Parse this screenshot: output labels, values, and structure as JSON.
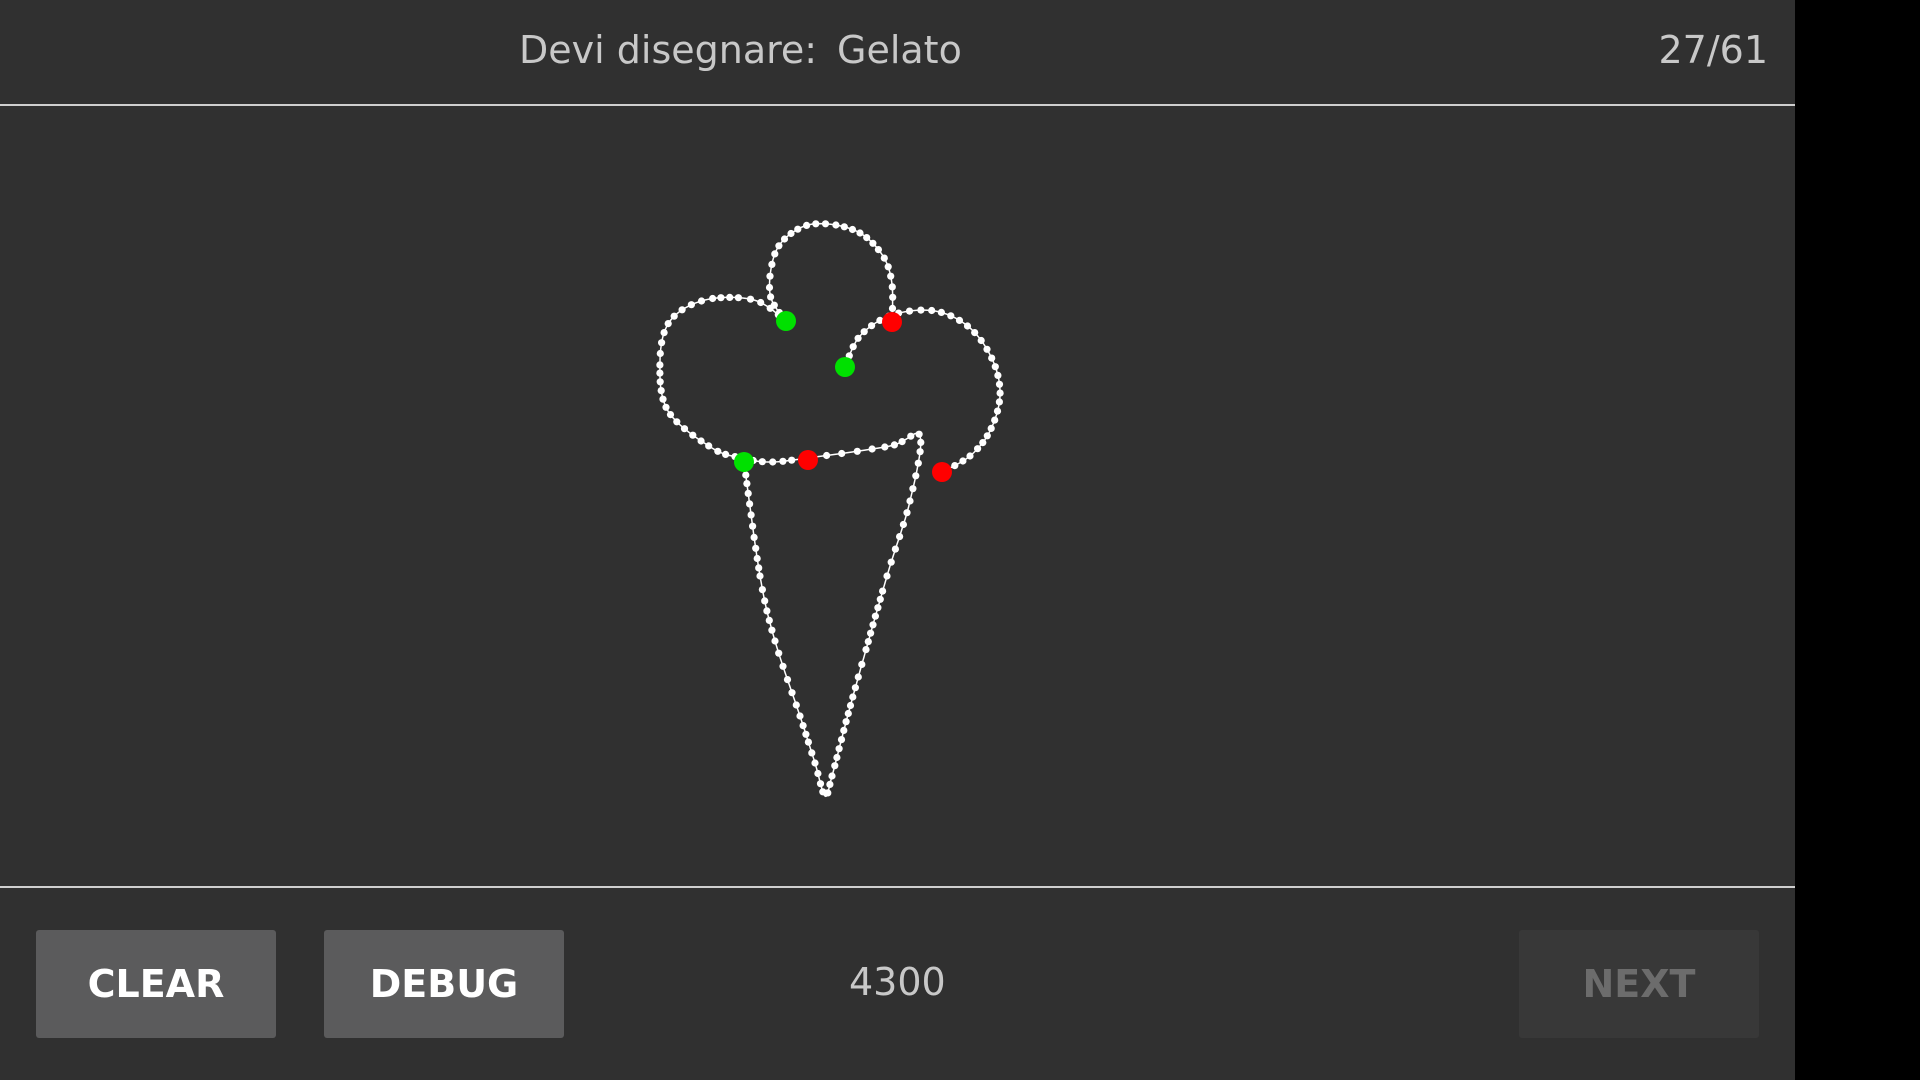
{
  "header": {
    "prompt_label": "Devi disegnare:",
    "prompt_word": "Gelato",
    "progress": "27/61"
  },
  "footer": {
    "clear_label": "CLEAR",
    "debug_label": "DEBUG",
    "score": "4300",
    "next_label": "NEXT",
    "next_enabled": false
  },
  "drawing": {
    "subject": "ice-cream-cone",
    "stroke_color": "#ffffff",
    "stroke_start_color": "#00e000",
    "stroke_end_color": "#ff0000",
    "stroke_count": 3
  },
  "colors": {
    "background": "#303030",
    "text": "#c8c8c8",
    "divider": "#cfcfcf",
    "button": "#5b5b5c",
    "button_disabled": "#383838"
  }
}
